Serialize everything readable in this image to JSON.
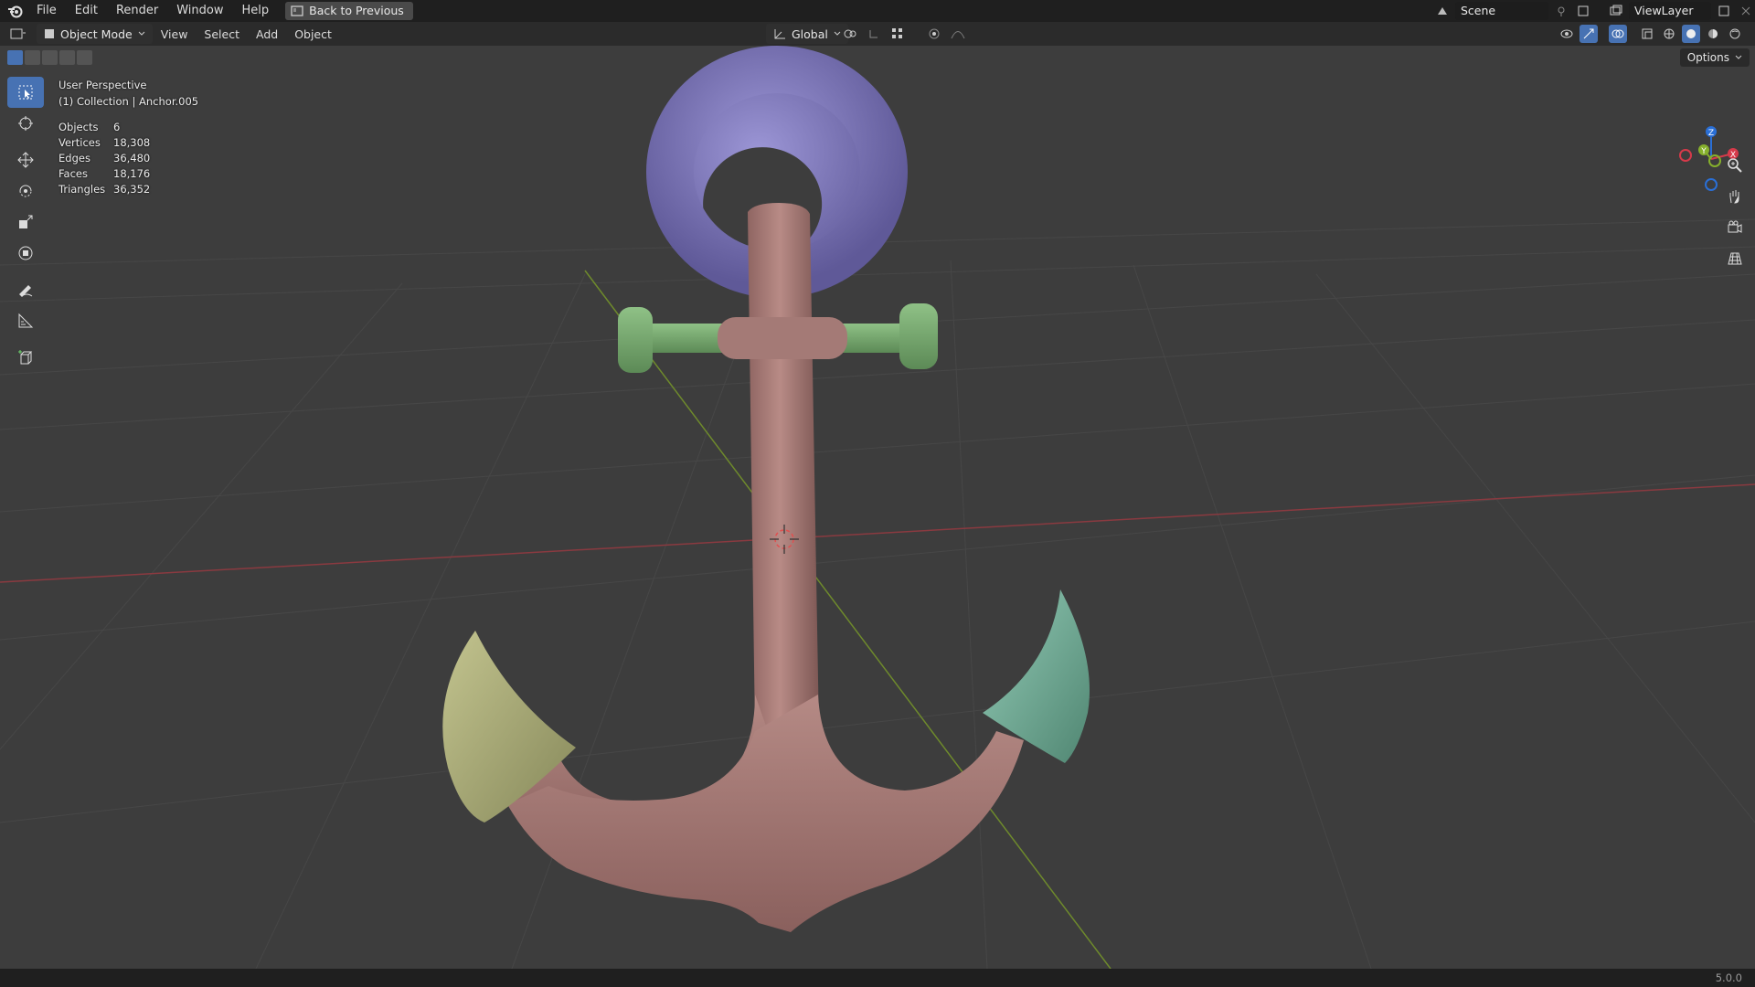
{
  "menu": {
    "items": [
      "File",
      "Edit",
      "Render",
      "Window",
      "Help"
    ],
    "back_button": "Back to Previous"
  },
  "topright": {
    "scene": "Scene",
    "view_layer": "ViewLayer"
  },
  "header": {
    "mode": "Object Mode",
    "menus": [
      "View",
      "Select",
      "Add",
      "Object"
    ],
    "transform_orientation": "Global",
    "options": "Options"
  },
  "overlay": {
    "perspective": "User Perspective",
    "collection": "(1) Collection | Anchor.005",
    "stats": [
      {
        "label": "Objects",
        "value": "6"
      },
      {
        "label": "Vertices",
        "value": "18,308"
      },
      {
        "label": "Edges",
        "value": "36,480"
      },
      {
        "label": "Faces",
        "value": "18,176"
      },
      {
        "label": "Triangles",
        "value": "36,352"
      }
    ]
  },
  "gizmo": {
    "x": "X",
    "y": "Y",
    "z": "Z"
  },
  "colors": {
    "shank": "#a87c78",
    "ring": "#7c76b4",
    "stock": "#76a56e",
    "fluke_left": "#a7a875",
    "fluke_right": "#6fa896",
    "accent": "#4772b3"
  },
  "icons": [
    "blender-logo-icon",
    "back-icon",
    "editor-type-icon",
    "cursor-icon",
    "move-icon",
    "rotate-icon",
    "scale-icon",
    "transform-icon",
    "annotate-icon",
    "measure-icon",
    "add-cube-icon",
    "zoom-icon",
    "hand-icon",
    "camera-icon",
    "grid-icon"
  ],
  "status": {
    "version": "5.0.0"
  }
}
